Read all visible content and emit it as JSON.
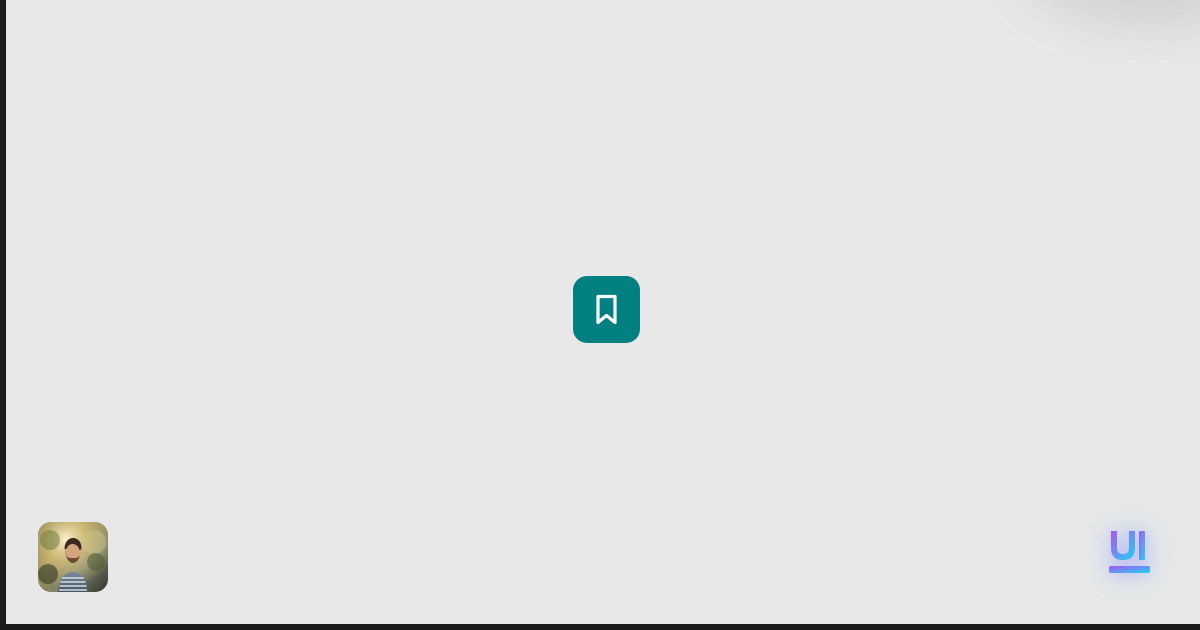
{
  "colors": {
    "outer_background": "#1b1b1b",
    "canvas_background": "#e8e8e8",
    "button_background": "#008080",
    "button_icon": "#ffffff",
    "logo_gradient_start": "#a855f7",
    "logo_gradient_end": "#22d3ee"
  },
  "icons": {
    "bookmark": "bookmark-icon",
    "avatar": "avatar-photo",
    "brand": "ui-logo"
  },
  "brand": {
    "logo_text": "UI"
  }
}
